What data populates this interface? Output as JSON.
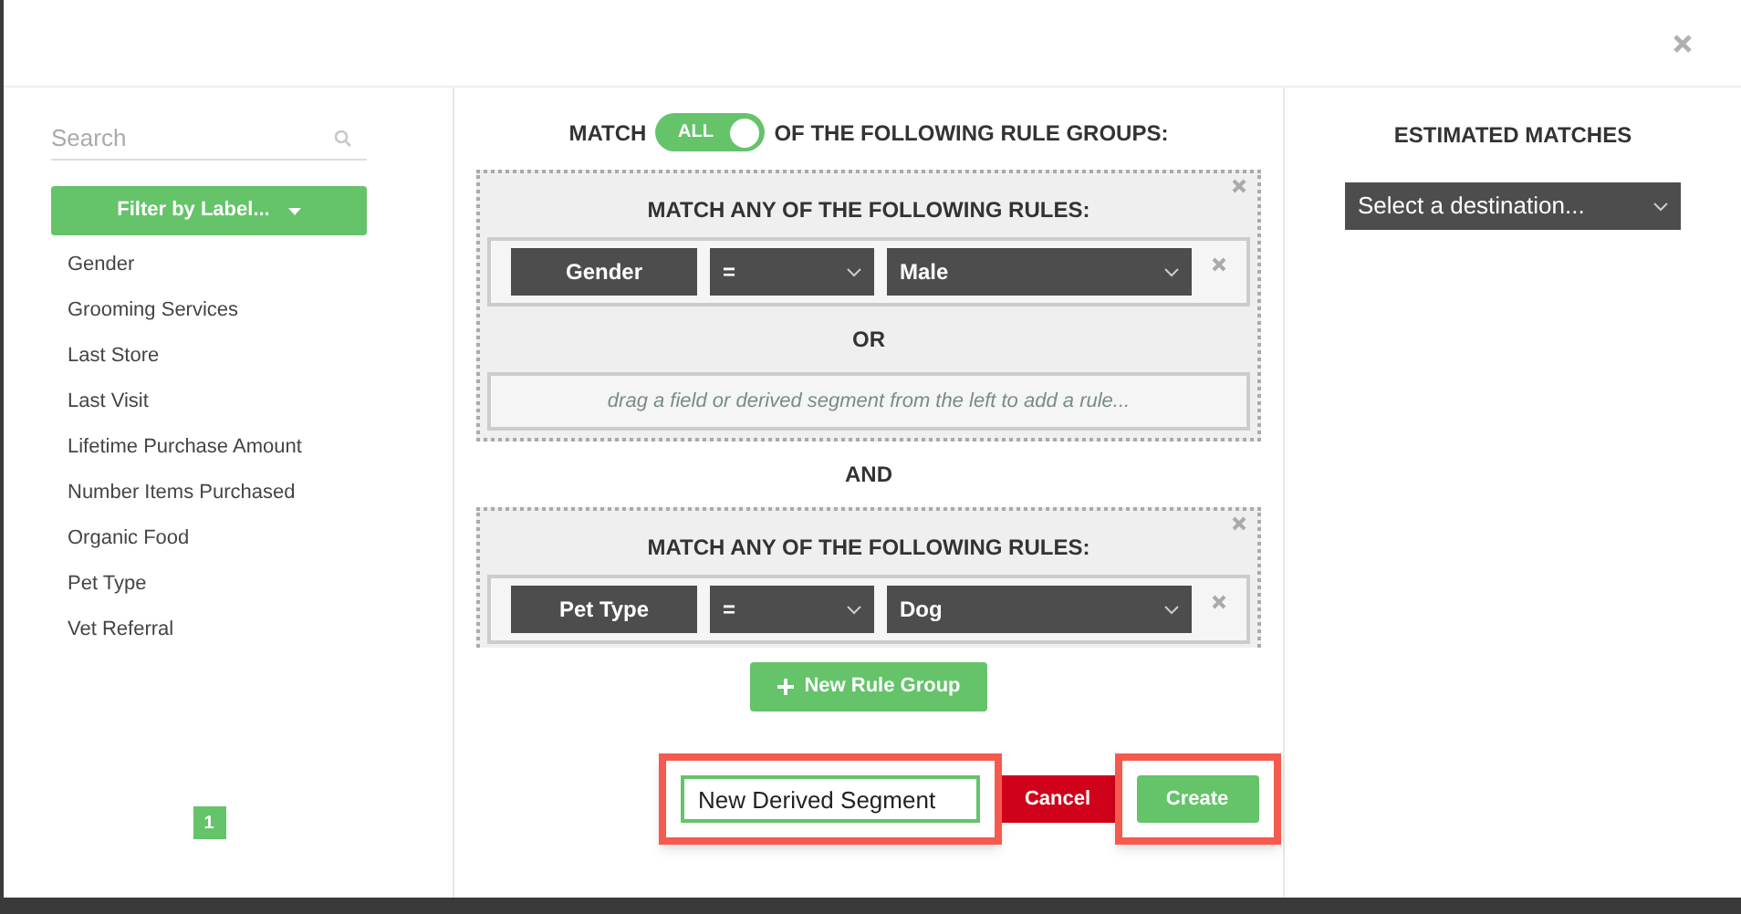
{
  "sidebar": {
    "search": {
      "placeholder": "Search"
    },
    "filter_button": "Filter by Label...",
    "fields": [
      "Gender",
      "Grooming Services",
      "Last Store",
      "Last Visit",
      "Lifetime Purchase Amount",
      "Number Items Purchased",
      "Organic Food",
      "Pet Type",
      "Vet Referral"
    ],
    "pages": [
      {
        "label": "1",
        "selected": true
      }
    ]
  },
  "builder": {
    "match_label": "MATCH",
    "toggle": {
      "label": "ALL",
      "on": true
    },
    "match_suffix": "OF THE FOLLOWING RULE GROUPS:",
    "groups": [
      {
        "title": "MATCH ANY OF THE FOLLOWING RULES:",
        "rules": [
          {
            "field": "Gender",
            "operator": "=",
            "value": "Male"
          }
        ],
        "connector": "OR",
        "drop_hint": "drag a field or derived segment from the left to add a rule..."
      },
      {
        "title": "MATCH ANY OF THE FOLLOWING RULES:",
        "rules": [
          {
            "field": "Pet Type",
            "operator": "=",
            "value": "Dog"
          }
        ]
      }
    ],
    "group_connector": "AND",
    "new_group_button": "New Rule Group"
  },
  "footer": {
    "name_field": {
      "value": "New Derived Segment"
    },
    "cancel": "Cancel",
    "create": "Create"
  },
  "estimates": {
    "title": "ESTIMATED MATCHES",
    "destination": "Select a destination..."
  }
}
